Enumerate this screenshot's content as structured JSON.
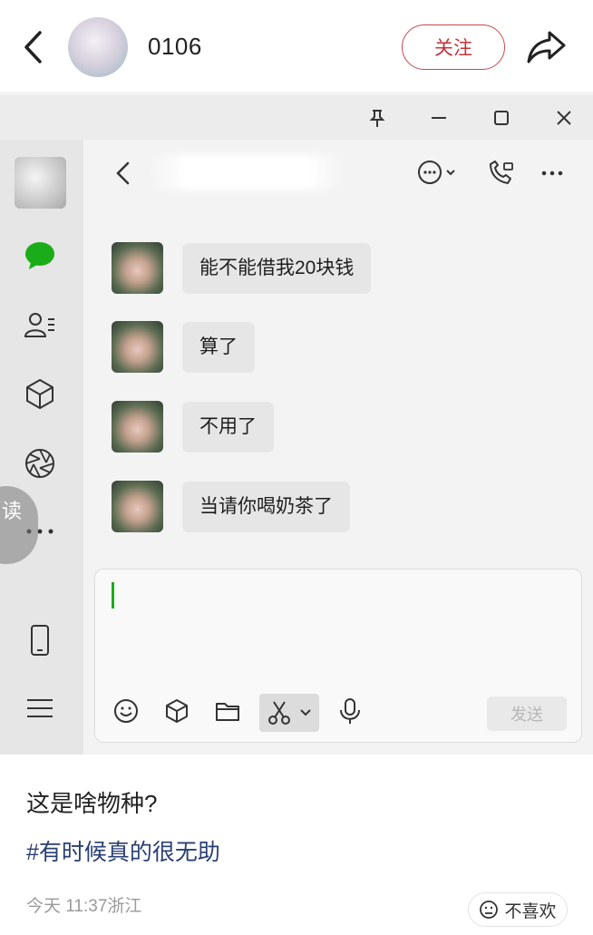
{
  "header": {
    "username": "0106",
    "follow_label": "关注",
    "icons": {
      "back": "chevron-left-icon",
      "share": "share-arrow-icon"
    },
    "accent_color": "#c0333a"
  },
  "screenshot": {
    "window_controls": [
      "pin-icon",
      "minimize-icon",
      "maximize-icon",
      "close-icon"
    ],
    "sidebar_icons": [
      "chat-bubble-icon",
      "contacts-icon",
      "cube-icon",
      "shutter-icon",
      "more-dots-icon",
      "phone-icon",
      "menu-icon"
    ],
    "floating_badge_text": "读",
    "chat": {
      "messages": [
        {
          "text": "能不能借我20块钱"
        },
        {
          "text": "算了"
        },
        {
          "text": "不用了"
        },
        {
          "text": "当请你喝奶茶了"
        }
      ],
      "toolbar_icons": [
        "emoji-icon",
        "sticker-cube-icon",
        "folder-icon",
        "scissors-icon",
        "microphone-icon"
      ],
      "send_label": "发送",
      "caret_color": "#1aad19"
    }
  },
  "post": {
    "title": "这是啥物种?",
    "hashtag": "#有时候真的很无助",
    "meta": "今天 11:37浙江",
    "dislike_label": "不喜欢"
  }
}
